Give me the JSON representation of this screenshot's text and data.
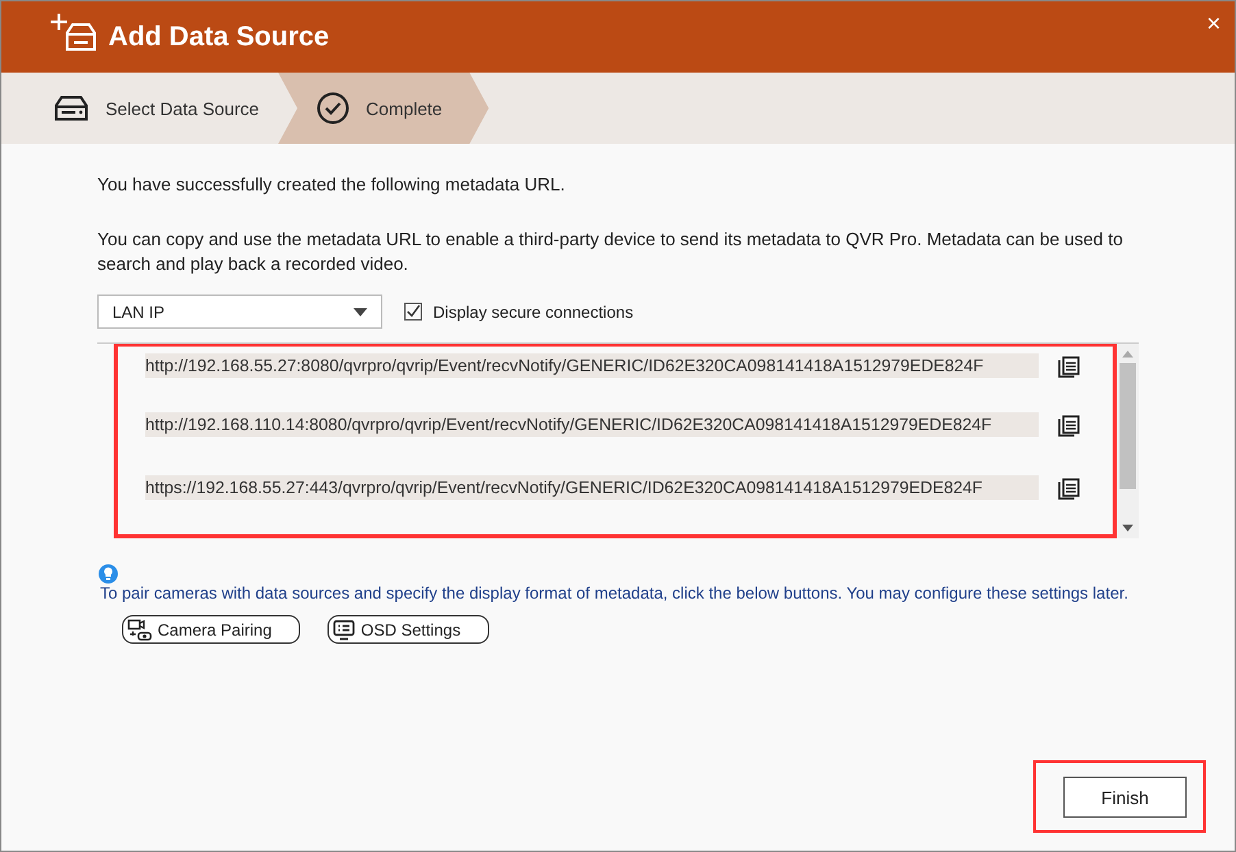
{
  "window": {
    "title": "Add Data Source",
    "close": "×"
  },
  "steps": [
    {
      "label": "Select Data Source",
      "selected": false
    },
    {
      "label": "Complete",
      "selected": true
    }
  ],
  "intro": "You have successfully created the following metadata URL.",
  "description": "You can copy and use the metadata URL to enable a third-party device to send its metadata to QVR Pro. Metadata can be used to search and play back a recorded video.",
  "network_select": {
    "value": "LAN IP"
  },
  "secure_checkbox": {
    "label": "Display secure connections",
    "checked": true
  },
  "urls": [
    "http://192.168.55.27:8080/qvrpro/qvrip/Event/recvNotify/GENERIC/ID62E320CA098141418A1512979EDE824F",
    "http://192.168.110.14:8080/qvrpro/qvrip/Event/recvNotify/GENERIC/ID62E320CA098141418A1512979EDE824F",
    "https://192.168.55.27:443/qvrpro/qvrip/Event/recvNotify/GENERIC/ID62E320CA098141418A1512979EDE824F"
  ],
  "tip": "To pair cameras with data sources and specify the display format of metadata, click the below buttons. You may configure these settings later.",
  "action_buttons": [
    {
      "label": "Camera Pairing"
    },
    {
      "label": "OSD Settings"
    }
  ],
  "finish_button": "Finish"
}
